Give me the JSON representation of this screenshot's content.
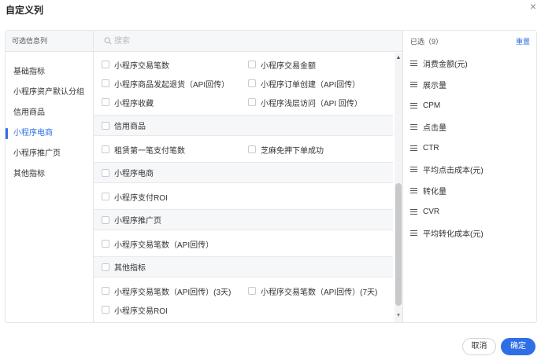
{
  "dialog": {
    "title": "自定义列",
    "close_glyph": "×"
  },
  "left": {
    "header": "可选信息列",
    "items": [
      {
        "label": "基础指标",
        "active": false
      },
      {
        "label": "小程序资产默认分组",
        "active": false
      },
      {
        "label": "信用商品",
        "active": false
      },
      {
        "label": "小程序电商",
        "active": true
      },
      {
        "label": "小程序推广页",
        "active": false
      },
      {
        "label": "其他指标",
        "active": false
      }
    ]
  },
  "search": {
    "placeholder": "搜索",
    "value": ""
  },
  "middle": {
    "top_rows": [
      [
        "小程序交易笔数",
        "小程序交易金额"
      ],
      [
        "小程序商品发起退货（API回传）",
        "小程序订单创建（API回传）"
      ],
      [
        "小程序收藏",
        "小程序浅层访问（API 回传）"
      ]
    ],
    "groups": [
      {
        "label": "信用商品",
        "rows": [
          [
            "租赁第一笔支付笔数",
            "芝麻免押下单成功"
          ]
        ]
      },
      {
        "label": "小程序电商",
        "rows": [
          [
            "小程序支付ROI"
          ]
        ]
      },
      {
        "label": "小程序推广页",
        "rows": [
          [
            "小程序交易笔数（API回传）"
          ]
        ]
      },
      {
        "label": "其他指标",
        "rows": [
          [
            "小程序交易笔数（API回传）(3天)",
            "小程序交易笔数（API回传）(7天)"
          ],
          [
            "小程序交易ROI"
          ]
        ]
      }
    ]
  },
  "right": {
    "count_label": "已选（9）",
    "reset_label": "重置",
    "selected": [
      "消费金额(元)",
      "展示量",
      "CPM",
      "点击量",
      "CTR",
      "平均点击成本(元)",
      "转化量",
      "CVR",
      "平均转化成本(元)"
    ]
  },
  "footer": {
    "cancel_label": "取消",
    "ok_label": "确定"
  },
  "colors": {
    "accent": "#2f6fe6",
    "border": "#e3e5ea",
    "header_bg": "#f6f7f9"
  },
  "icons": {
    "search": "search-icon",
    "close": "close-icon",
    "drag": "drag-handle-icon"
  }
}
